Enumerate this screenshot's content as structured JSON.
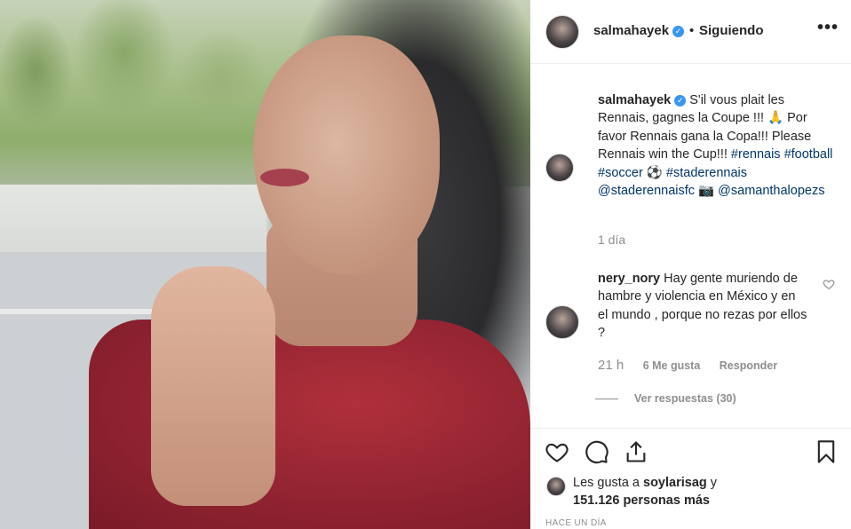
{
  "post": {
    "username": "salmahayek",
    "follow_status": "Siguiendo",
    "separator": "•",
    "more_label": "•••"
  },
  "caption": {
    "username": "salmahayek",
    "text_1": "S'il vous plait les Rennais, gagnes la Coupe !!! 🙏 Por favor Rennais gana la Copa!!! Please Rennais win the Cup!!! ",
    "tag_rennais": "#rennais",
    "tag_football": "#football",
    "tag_soccer": "#soccer",
    "soccer_emoji": "⚽",
    "tag_staderennais": "#staderennais",
    "mention_club": "@staderennaisfc",
    "camera_emoji": "📷",
    "mention_photographer": "@samanthalopezs",
    "time": "1 día"
  },
  "comment": {
    "username": "nery_nory",
    "text": "Hay gente muriendo de hambre y violencia en México y en el mundo , porque no rezas por ellos ?",
    "time": "21 h",
    "likes": "6 Me gusta",
    "reply": "Responder",
    "view_replies": "Ver respuestas (30)"
  },
  "likes": {
    "prefix": "Les gusta a",
    "user": "soylarisag",
    "connector": "y",
    "count": "151.126 personas más"
  },
  "timestamp": "HACE UN DÍA",
  "icons": [
    "heart-icon",
    "comment-icon",
    "share-icon",
    "bookmark-icon",
    "verified-badge-icon",
    "more-options-icon"
  ]
}
